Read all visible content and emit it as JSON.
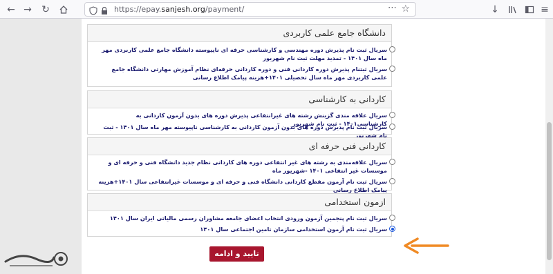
{
  "browser": {
    "url_prefix": "https://epay.",
    "url_domain": "sanjesh.org",
    "url_path": "/payment/",
    "more_icon": "⋯"
  },
  "sections": [
    {
      "title": "دانشگاه جامع علمی کاربردی",
      "options": [
        "سریال ثبت نام پذیرش دوره مهندسی و کارشناسی حرفه ای ناپیوسته دانشگاه جامع علمی کاربردی مهر ماه سال ۱۴۰۱ - تمدید مهلت ثبت نام شهریور",
        "سریال ثبتنام پذیرش دوره کاردانی فنی و دوره کاردانی حرفه‌ای نظام آموزش مهارتی دانشگاه جامع علمی کاربردی مهر ماه سال تحصیلی ۱۴۰۱+هزینه پیامک اطلاع رسانی"
      ]
    },
    {
      "title": "کاردانی به کارشناسی",
      "options": [
        "سریال علاقه مندی گزینش رشته های غیرانتفاعی پذیرش دوره های بدون آزمون کاردانی به کارشناسی۱۴۰۱ - ثبت نام شهریور",
        "سریال ثبت نام پذیرش دوره های بدون آزمون کاردانی به کارشناسی ناپیوسته مهر ماه سال ۱۴۰۱ - ثبت نام شهریور"
      ]
    },
    {
      "title": "کاردانی فنی حرفه ای",
      "options": [
        "سریال علاقه‌مندی به رشته های غیر انتفاعی دوره های کاردانی نظام جدید دانشگاه فنی و حرفه ای و موسسات غیر انتفاعی ۱۴۰۱ -شهریور ماه",
        "سریال ثبت نام آزمون مقطع کاردانی دانشگاه فنی و حرفه ای و موسسات غیرانتفاعی سال ۱۴۰۱+هزینه پیامک اطلاع رسانی"
      ]
    },
    {
      "title": "ازمون استخدامی",
      "options": [
        "سریال ثبت نام پنجمین آزمون ورودی انتخاب اعضای جامعه مشاوران رسمی مالیاتی ایران سال ۱۴۰۱",
        "سریال ثبت نام آزمون استخدامی سازمان تامین اجتماعی سال ۱۴۰۱"
      ],
      "selected_index": 1
    }
  ],
  "submit_label": "تایید و ادامه",
  "colors": {
    "accent": "#a8162e",
    "arrow": "#f08a24",
    "link_text": "#1a1a6e"
  }
}
